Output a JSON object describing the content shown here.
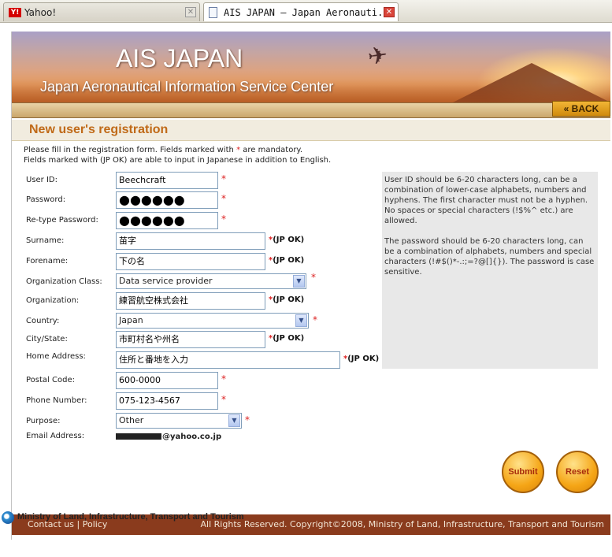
{
  "browser": {
    "tabs": [
      {
        "title": "Yahoo!",
        "icon": "yahoo-favicon"
      },
      {
        "title": "AIS JAPAN – Japan Aeronauti...",
        "icon": "document-icon"
      }
    ]
  },
  "banner": {
    "title": "AIS JAPAN",
    "subtitle": "Japan Aeronautical Information Service Center",
    "back_label": "« BACK"
  },
  "page": {
    "heading": "New user's registration",
    "intro_line1_a": "Please fill in the registration form. Fields marked with ",
    "intro_star": "*",
    "intro_line1_b": " are mandatory.",
    "intro_line2": "Fields marked with (JP OK) are able to input in Japanese in addition to English."
  },
  "form": {
    "user_id": {
      "label": "User ID:",
      "value": "Beechcraft"
    },
    "password": {
      "label": "Password:",
      "value": "●●●●●●"
    },
    "retype_password": {
      "label": "Re-type Password:",
      "value": "●●●●●●"
    },
    "surname": {
      "label": "Surname:",
      "value": "苗字"
    },
    "forename": {
      "label": "Forename:",
      "value": "下の名"
    },
    "organization_class": {
      "label": "Organization Class:",
      "value": "Data service provider"
    },
    "organization": {
      "label": "Organization:",
      "value": "練習航空株式会社"
    },
    "country": {
      "label": "Country:",
      "value": "Japan"
    },
    "city_state": {
      "label": "City/State:",
      "value": "市町村名や州名"
    },
    "home_address": {
      "label": "Home Address:",
      "value": "住所と番地を入力"
    },
    "postal_code": {
      "label": "Postal Code:",
      "value": "600-0000"
    },
    "phone_number": {
      "label": "Phone Number:",
      "value": "075-123-4567"
    },
    "purpose": {
      "label": "Purpose:",
      "value": "Other"
    },
    "email": {
      "label": "Email Address:",
      "value": "@yahoo.co.jp"
    },
    "required_mark": "*",
    "jp_ok": "(JP OK)"
  },
  "help": {
    "userid_text": "User ID should be 6-20 characters long, can be a combination of lower-case alphabets, numbers and hyphens. The first character must not be a hyphen. No spaces or special characters (!$%^ etc.) are allowed.",
    "password_text": "The password should be 6-20 characters long, can be a combination of alphabets, numbers and special characters (!#$()*-.:;=?@[]{}). The password is case sensitive."
  },
  "buttons": {
    "submit": "Submit",
    "reset": "Reset"
  },
  "footer": {
    "contact": "Contact us",
    "separator": "|",
    "policy": "Policy",
    "copyright": "All Rights Reserved. Copyright©2008, Ministry of Land, Infrastructure, Transport and Tourism"
  },
  "ministry": {
    "name": "Ministry of Land, Infrastructure, Transport and Tourism"
  },
  "colors": {
    "heading": "#c06a18",
    "footer_bg": "#8a3b1d",
    "required": "#dd2222",
    "button_orange": "#f5a516"
  }
}
